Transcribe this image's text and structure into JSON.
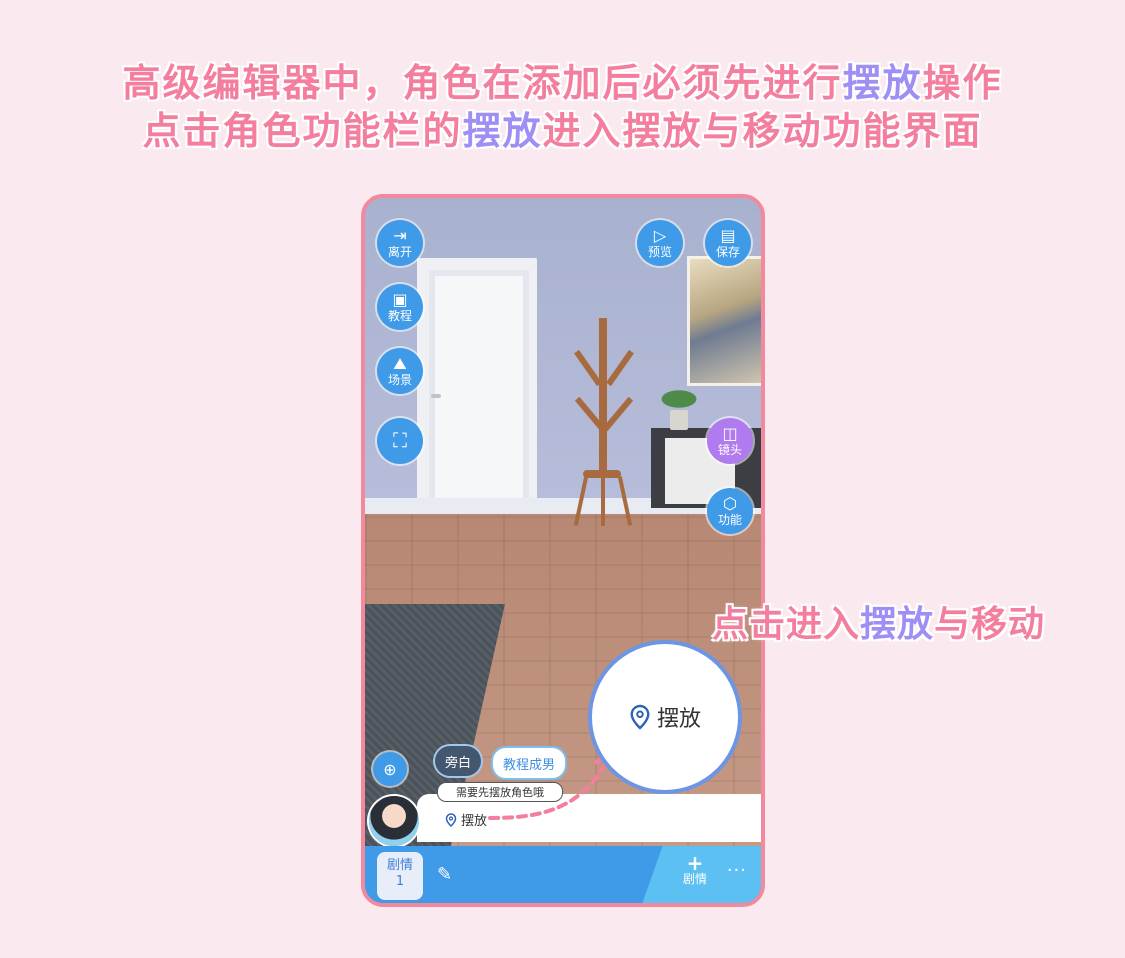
{
  "headline": {
    "line1": {
      "prefix": "高级编辑器中，角色在添加后必须先进行",
      "highlight": "摆放",
      "suffix": "操作"
    },
    "line2": {
      "prefix": "点击角色功能栏的",
      "highlight": "摆放",
      "suffix": "进入摆放与移动功能界面"
    }
  },
  "callout": {
    "prefix": "点击进入",
    "highlight": "摆放",
    "suffix": "与移动"
  },
  "left_toolbar": {
    "leave": "离开",
    "tutorial": "教程",
    "scene": "场景"
  },
  "top_right": {
    "preview": "预览",
    "save": "保存"
  },
  "right_toolbar": {
    "camera": "镜头",
    "function": "功能"
  },
  "dialog": {
    "narration": "旁白",
    "character": "教程成男",
    "hint": "需要先摆放角色哦",
    "place": "摆放"
  },
  "zoom": {
    "place": "摆放"
  },
  "bottom_bar": {
    "scene_tab_label": "剧情",
    "scene_tab_number": "1",
    "add_label": "剧情",
    "more": "···"
  },
  "colors": {
    "accent_pink": "#f37e9d",
    "accent_purple": "#9f8ff5",
    "ui_blue": "#3f9ae8"
  }
}
